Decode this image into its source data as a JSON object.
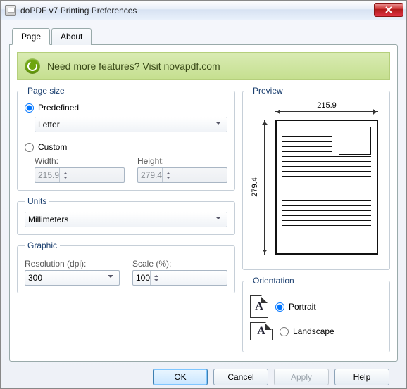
{
  "window": {
    "title": "doPDF v7 Printing Preferences"
  },
  "tabs": {
    "page": "Page",
    "about": "About"
  },
  "banner": {
    "text": "Need more features? Visit novapdf.com"
  },
  "page_size": {
    "legend": "Page size",
    "predefined_label": "Predefined",
    "custom_label": "Custom",
    "preset": "Letter",
    "width_label": "Width:",
    "height_label": "Height:",
    "width": "215.9",
    "height": "279.4"
  },
  "units": {
    "legend": "Units",
    "value": "Millimeters"
  },
  "graphic": {
    "legend": "Graphic",
    "resolution_label": "Resolution (dpi):",
    "scale_label": "Scale (%):",
    "resolution": "300",
    "scale": "100"
  },
  "preview": {
    "legend": "Preview",
    "width": "215.9",
    "height": "279.4"
  },
  "orientation": {
    "legend": "Orientation",
    "portrait_label": "Portrait",
    "landscape_label": "Landscape",
    "glyph": "A"
  },
  "buttons": {
    "ok": "OK",
    "cancel": "Cancel",
    "apply": "Apply",
    "help": "Help"
  }
}
